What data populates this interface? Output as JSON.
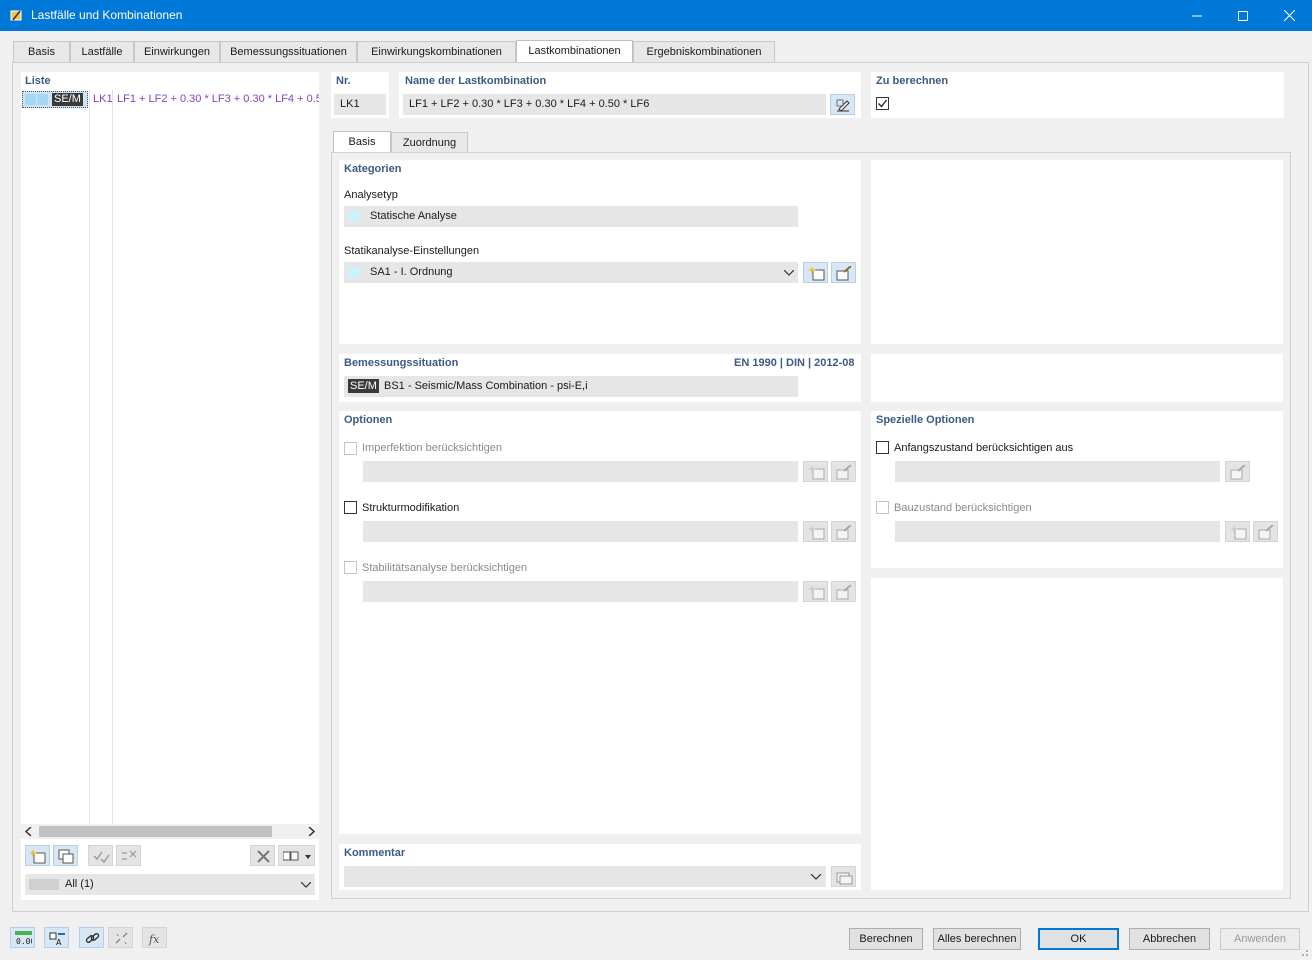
{
  "window": {
    "title": "Lastfälle und Kombinationen",
    "minimize": "—",
    "maximize": "☐",
    "close": "✕"
  },
  "tabs": [
    {
      "label": "Basis"
    },
    {
      "label": "Lastfälle"
    },
    {
      "label": "Einwirkungen"
    },
    {
      "label": "Bemessungssituationen"
    },
    {
      "label": "Einwirkungskombinationen"
    },
    {
      "label": "Lastkombinationen"
    },
    {
      "label": "Ergebniskombinationen"
    }
  ],
  "active_tab": "Lastkombinationen",
  "list": {
    "title": "Liste",
    "items": [
      {
        "badge": "SE/M",
        "id": "LK1",
        "text": "LF1 + LF2 + 0.30 * LF3 + 0.30 * LF4 + 0.5"
      }
    ],
    "filter": "All (1)"
  },
  "header": {
    "nr_label": "Nr.",
    "nr_value": "LK1",
    "name_label": "Name der Lastkombination",
    "name_value": "LF1 + LF2 + 0.30 * LF3 + 0.30 * LF4 + 0.50 * LF6",
    "calc_label": "Zu berechnen",
    "calc_checked": true
  },
  "subtabs": [
    {
      "label": "Basis"
    },
    {
      "label": "Zuordnung"
    }
  ],
  "kategorien": {
    "title": "Kategorien",
    "analysetyp_label": "Analysetyp",
    "analysetyp_value": "Statische Analyse",
    "statik_label": "Statikanalyse-Einstellungen",
    "statik_value": "SA1 - I. Ordnung"
  },
  "bemessung": {
    "title": "Bemessungssituation",
    "norm": "EN 1990 | DIN | 2012-08",
    "badge": "SE/M",
    "value": "BS1 - Seismic/Mass Combination - psi-E,i"
  },
  "optionen": {
    "title": "Optionen",
    "items": [
      {
        "label": "Imperfektion berücksichtigen",
        "enabled": false
      },
      {
        "label": "Strukturmodifikation",
        "enabled": true
      },
      {
        "label": "Stabilitätsanalyse berücksichtigen",
        "enabled": false
      }
    ]
  },
  "spezielle": {
    "title": "Spezielle Optionen",
    "items": [
      {
        "label": "Anfangszustand berücksichtigen aus",
        "enabled": true
      },
      {
        "label": "Bauzustand berücksichtigen",
        "enabled": false
      }
    ]
  },
  "kommentar": {
    "title": "Kommentar",
    "value": ""
  },
  "footer": {
    "berechnen": "Berechnen",
    "alles": "Alles berechnen",
    "ok": "OK",
    "abbrechen": "Abbrechen",
    "anwenden": "Anwenden"
  },
  "colors": {
    "accent": "#0078d7",
    "section_title": "#3b5a86",
    "lk_purple": "#8a3fbf",
    "badge_bg": "#3a3a3a",
    "swatch": "#ccf2ff"
  }
}
